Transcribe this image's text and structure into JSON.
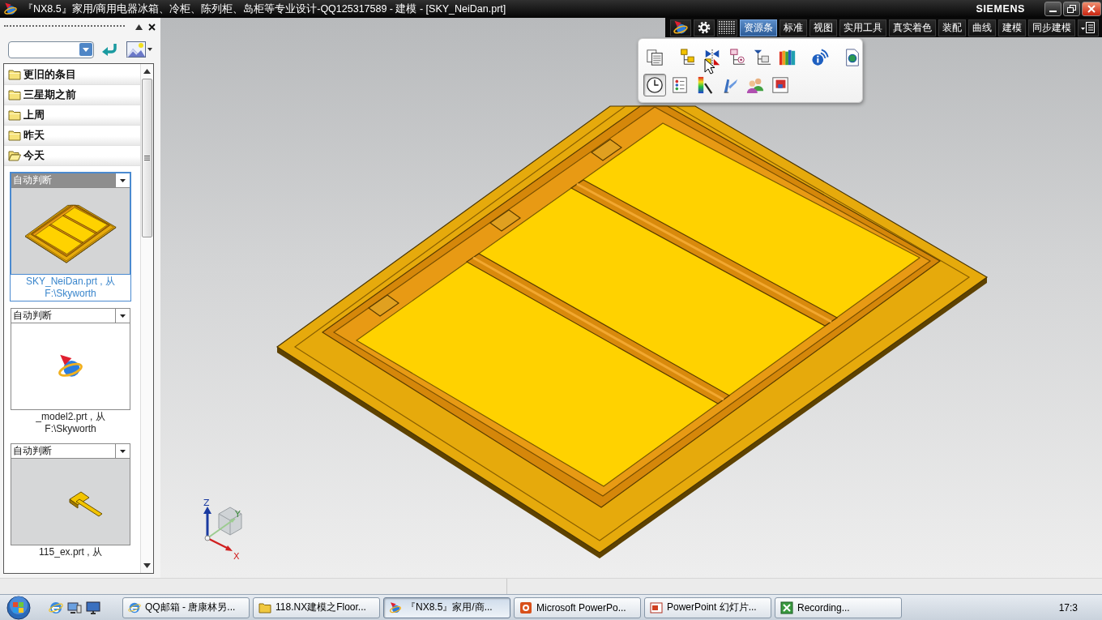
{
  "window": {
    "title": "『NX8.5』家用/商用电器冰箱、冷柜、陈列柜、岛柜等专业设计-QQ125317589 - 建模 - [SKY_NeiDan.prt]",
    "brand": "SIEMENS"
  },
  "toolbar": {
    "tabs": [
      {
        "label": "资源条",
        "selected": true
      },
      {
        "label": "标准",
        "selected": false
      },
      {
        "label": "视图",
        "selected": false
      },
      {
        "label": "实用工具",
        "selected": false
      },
      {
        "label": "真实着色",
        "selected": false
      },
      {
        "label": "装配",
        "selected": false
      },
      {
        "label": "曲线",
        "selected": false
      },
      {
        "label": "建模",
        "selected": false
      },
      {
        "label": "同步建模",
        "selected": false
      }
    ]
  },
  "resource_popup": {
    "rows": [
      [
        {
          "selected": false
        },
        {
          "selected": false
        },
        {
          "selected": false
        },
        {
          "selected": false
        },
        {
          "selected": false
        },
        {
          "selected": false
        },
        {
          "selected": false
        },
        {
          "selected": false
        }
      ],
      [
        {
          "selected": true
        },
        {
          "selected": false
        },
        {
          "selected": false
        },
        {
          "selected": false
        },
        {
          "selected": false
        },
        {
          "selected": false
        }
      ]
    ]
  },
  "history_panel": {
    "groups": [
      {
        "label": "更旧的条目",
        "expanded": false
      },
      {
        "label": "三星期之前",
        "expanded": false
      },
      {
        "label": "上周",
        "expanded": false
      },
      {
        "label": "昨天",
        "expanded": false
      },
      {
        "label": "今天",
        "expanded": true
      }
    ],
    "items": [
      {
        "filter": "自动判断",
        "caption": "SKY_NeiDan.prt , 从 F:\\Skyworth",
        "selected": true
      },
      {
        "filter": "自动判断",
        "caption": "_model2.prt , 从 F:\\Skyworth",
        "selected": false
      },
      {
        "filter": "自动判断",
        "caption": "115_ex.prt , 从",
        "selected": false
      }
    ]
  },
  "view_triad": {
    "axis_labels": [
      "Z",
      "Y",
      "X"
    ]
  },
  "taskbar": {
    "buttons": [
      {
        "label": "QQ邮箱 - 唐康林另...",
        "selected": false
      },
      {
        "label": "118.NX建模之Floor...",
        "selected": false
      },
      {
        "label": "『NX8.5』家用/商...",
        "selected": true
      },
      {
        "label": "Microsoft PowerPo...",
        "selected": false
      },
      {
        "label": "PowerPoint 幻灯片...",
        "selected": false
      },
      {
        "label": "Recording...",
        "selected": false
      }
    ],
    "clock": "17:3"
  }
}
